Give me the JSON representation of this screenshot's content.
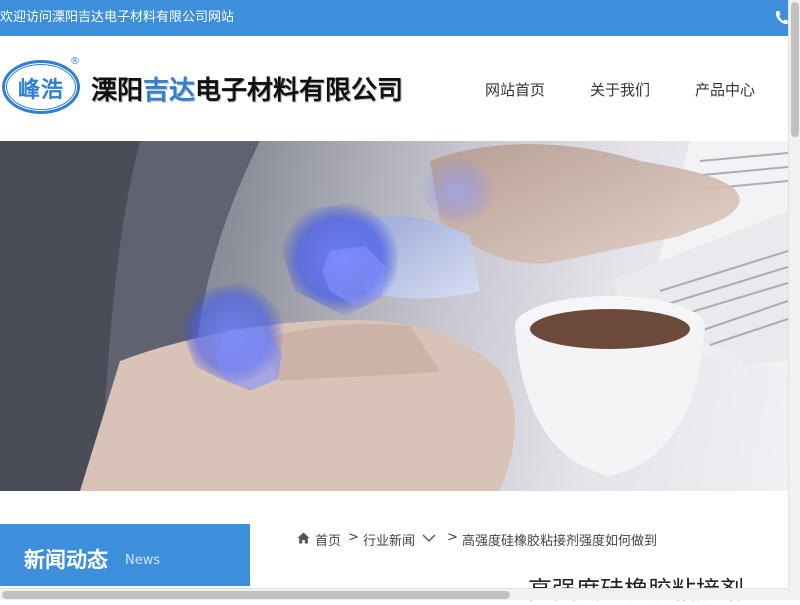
{
  "topbar": {
    "welcome": "欢迎访问溧阳吉达电子材料有限公司网站",
    "phone_icon": "phone-icon"
  },
  "header": {
    "logo_mark": "峰浩",
    "logo_reg": "®",
    "brand_part1": "溧阳",
    "brand_highlight": "吉达",
    "brand_part2": "电子材料有限公司"
  },
  "nav": {
    "items": [
      {
        "label": "网站首页"
      },
      {
        "label": "关于我们"
      },
      {
        "label": "产品中心"
      }
    ]
  },
  "sidebar": {
    "title": "新闻动态",
    "title_en": "News"
  },
  "breadcrumb": {
    "home_icon": "home-icon",
    "home": "首页",
    "sep1": ">",
    "category": "行业新闻",
    "dropdown_icon": "chevron-down-icon",
    "sep2": ">",
    "current": "高强度硅橡胶粘接剂强度如何做到"
  },
  "article": {
    "title": "高强度硅橡胶粘接剂"
  },
  "colors": {
    "primary": "#3d8fdb",
    "brand_blue": "#2f7fd2"
  }
}
